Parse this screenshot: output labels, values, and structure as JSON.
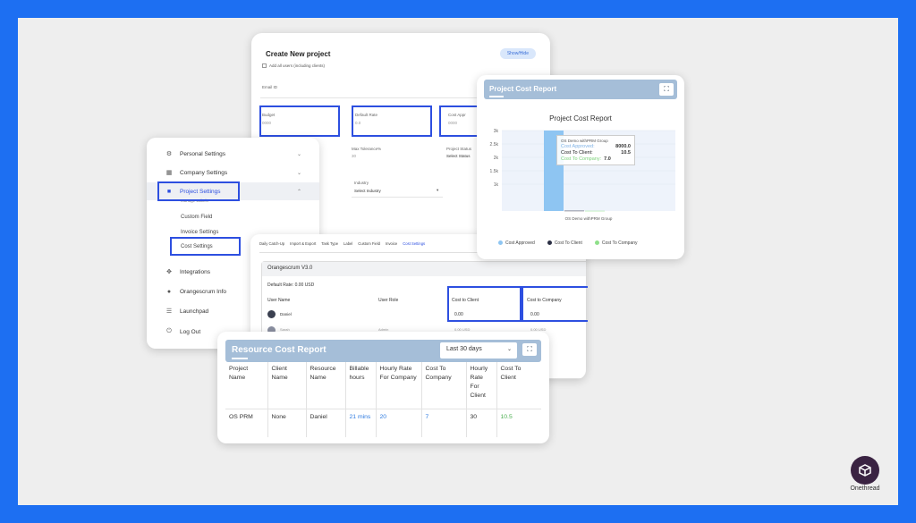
{
  "create_project": {
    "title": "Create New project",
    "show_hide": "Show/Hide",
    "add_all_users": "Add all users (including clients)",
    "email_label": "Email ID",
    "budget_label": "Budget",
    "budget_value": "0000",
    "default_rate_label": "Default Rate",
    "default_rate_value": "0.0",
    "cost_appr_label": "Cost Appr",
    "cost_appr_value": "0000",
    "max_tolerance_label": "Max Tolerance%",
    "max_tolerance_value": "30",
    "project_status_label": "Project Status",
    "project_status_value": "Select Status",
    "industry_label": "Industry",
    "industry_value": "Select Industry"
  },
  "settings_menu": {
    "items": [
      {
        "label": "Personal Settings",
        "icon": "user-settings-icon"
      },
      {
        "label": "Company Settings",
        "icon": "building-icon"
      },
      {
        "label": "Project Settings",
        "icon": "project-icon"
      },
      {
        "label": "Integrations",
        "icon": "integrations-icon"
      },
      {
        "label": "Orangescrum Info",
        "icon": "info-icon"
      },
      {
        "label": "Launchpad",
        "icon": "launchpad-icon"
      },
      {
        "label": "Log Out",
        "icon": "logout-icon"
      }
    ],
    "sub_items": [
      "Manage Labels",
      "Custom Field",
      "Invoice Settings",
      "Cost Settings"
    ]
  },
  "cost_settings": {
    "tabs": [
      "Daily Catch-Up",
      "Import & Export",
      "Task Type",
      "Label",
      "Custom Field",
      "Invoice",
      "Cost Settings"
    ],
    "company": "Orangescrum V3.0",
    "default_rate": "Default Rate: 0.00 USD",
    "col_user_name": "User Name",
    "col_user_role": "User Role",
    "col_cost_client": "Cost to Client",
    "col_cost_company": "Cost to Company",
    "row1_name": "Daniel",
    "row1_cost_client": "0.00",
    "row1_cost_company": "0.00",
    "row2_name": "Sarah",
    "row2_role": "Admin",
    "row2_cost_client": "0.00 USD",
    "row2_cost_company": "0.00 USD"
  },
  "project_cost_report": {
    "header": "Project Cost Report",
    "tooltip": {
      "title": "OS Demo withPRM Group",
      "rows": [
        {
          "label": "Cost Approved:",
          "value": "8000.0"
        },
        {
          "label": "Cost To Client:",
          "value": "10.5"
        },
        {
          "label": "Cost To Company:",
          "value": "7.0"
        }
      ]
    },
    "legend": [
      "Cost Approved",
      "Cost To Client",
      "Cost To Company"
    ]
  },
  "chart_data": {
    "type": "bar",
    "title": "Project Cost Report",
    "categories": [
      "OS Demo withPRM Group"
    ],
    "series": [
      {
        "name": "Cost Approved",
        "values": [
          8000.0
        ]
      },
      {
        "name": "Cost To Client",
        "values": [
          10.5
        ]
      },
      {
        "name": "Cost To Company",
        "values": [
          7.0
        ]
      }
    ],
    "y_ticks": [
      "3k",
      "2.5k",
      "2k",
      "1.5k",
      "1k"
    ],
    "ylim": [
      0,
      3000
    ],
    "grid": true,
    "legend_position": "bottom",
    "colors": {
      "Cost Approved": "#8ec5f2",
      "Cost To Client": "#2b2f44",
      "Cost To Company": "#8fe08a"
    }
  },
  "resource_cost_report": {
    "header": "Resource Cost Report",
    "range": "Last 30 days",
    "columns": [
      "Project Name",
      "Client Name",
      "Resource Name",
      "Billable hours",
      "Hourly Rate For Company",
      "Cost To Company",
      "Hourly Rate For Client",
      "Cost To Client"
    ],
    "rows": [
      [
        "OS PRM",
        "None",
        "Daniel",
        "21 mins",
        "20",
        "7",
        "30",
        "10.5"
      ]
    ]
  },
  "brand": {
    "name": "Onethread",
    "bg": "#1d6ff2"
  }
}
